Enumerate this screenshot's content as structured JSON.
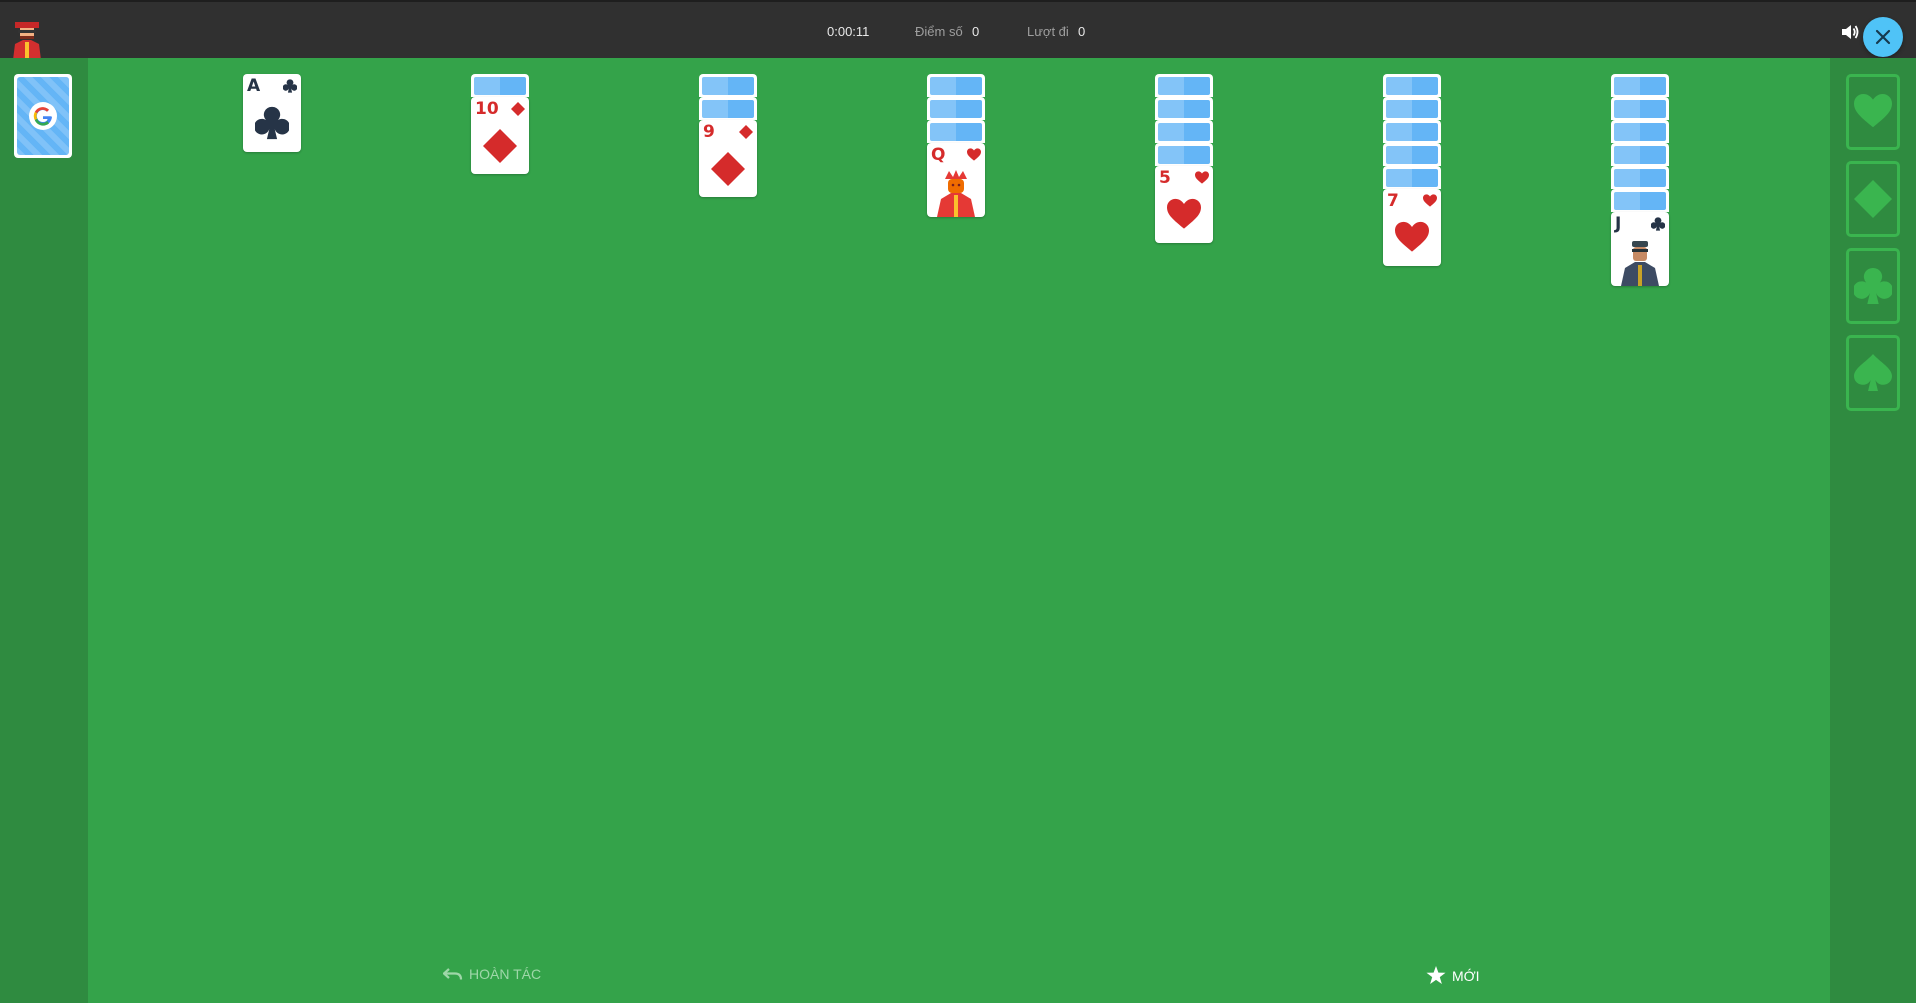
{
  "header": {
    "timer": "0:00:11",
    "score_label": "Điểm số",
    "score_value": "0",
    "moves_label": "Lượt đi",
    "moves_value": "0",
    "sound_icon": "speaker-icon",
    "close_icon": "close-icon"
  },
  "stock": {
    "logo": "G",
    "icon": "google-logo-icon"
  },
  "tableau": [
    {
      "hidden_count": 0,
      "rank": "A",
      "suit": "clubs",
      "color": "black"
    },
    {
      "hidden_count": 1,
      "rank": "10",
      "suit": "diamonds",
      "color": "red"
    },
    {
      "hidden_count": 2,
      "rank": "9",
      "suit": "diamonds",
      "color": "red"
    },
    {
      "hidden_count": 3,
      "rank": "Q",
      "suit": "hearts",
      "color": "red",
      "face_card": true
    },
    {
      "hidden_count": 4,
      "rank": "5",
      "suit": "hearts",
      "color": "red"
    },
    {
      "hidden_count": 5,
      "rank": "7",
      "suit": "hearts",
      "color": "red"
    },
    {
      "hidden_count": 6,
      "rank": "J",
      "suit": "clubs",
      "color": "black",
      "face_card": true
    }
  ],
  "foundations": [
    "hearts",
    "diamonds",
    "clubs",
    "spades"
  ],
  "footer": {
    "undo_label": "HOÀN TÁC",
    "new_label": "MỚI"
  },
  "colors": {
    "felt": "#34a34a",
    "side_panel": "#2f8b40",
    "topbar": "#303030",
    "card_back": "#64b5f6",
    "red_suit": "#d52b2b",
    "black_suit": "#263447",
    "close_button": "#4fc3f7"
  }
}
